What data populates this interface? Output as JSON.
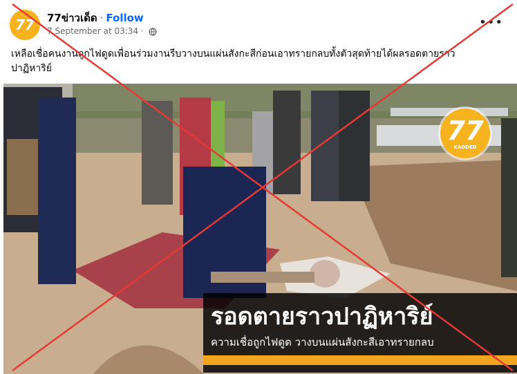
{
  "post": {
    "page_name": "77ข่าวเด็ด",
    "separator": "·",
    "follow_label": "Follow",
    "timestamp": "7 September at 03:34 ·",
    "privacy_icon": "globe-icon",
    "more_label": "•••",
    "caption": "เหลือเชื่อคนงานถูกไฟดูดเพื่อนร่วมงานรีบวางบนแผ่นสังกะสีก่อนเอาทรายกลบทั้งตัวสุดท้ายได้ผลรอดตายราว ปาฏิหาริย์"
  },
  "photo": {
    "headline": "รอดตายราวปาฏิหาริย์",
    "subheadline": "ความเชื่อถูกไฟดูด วางบนแผ่นสังกะสีเอาทรายกลบ",
    "logo_number": "77",
    "logo_sub": "KAODED"
  },
  "colors": {
    "cross": "#e53935",
    "brand": "#f7b31e",
    "accent_bar": "#f4a520",
    "link": "#0866ff"
  }
}
